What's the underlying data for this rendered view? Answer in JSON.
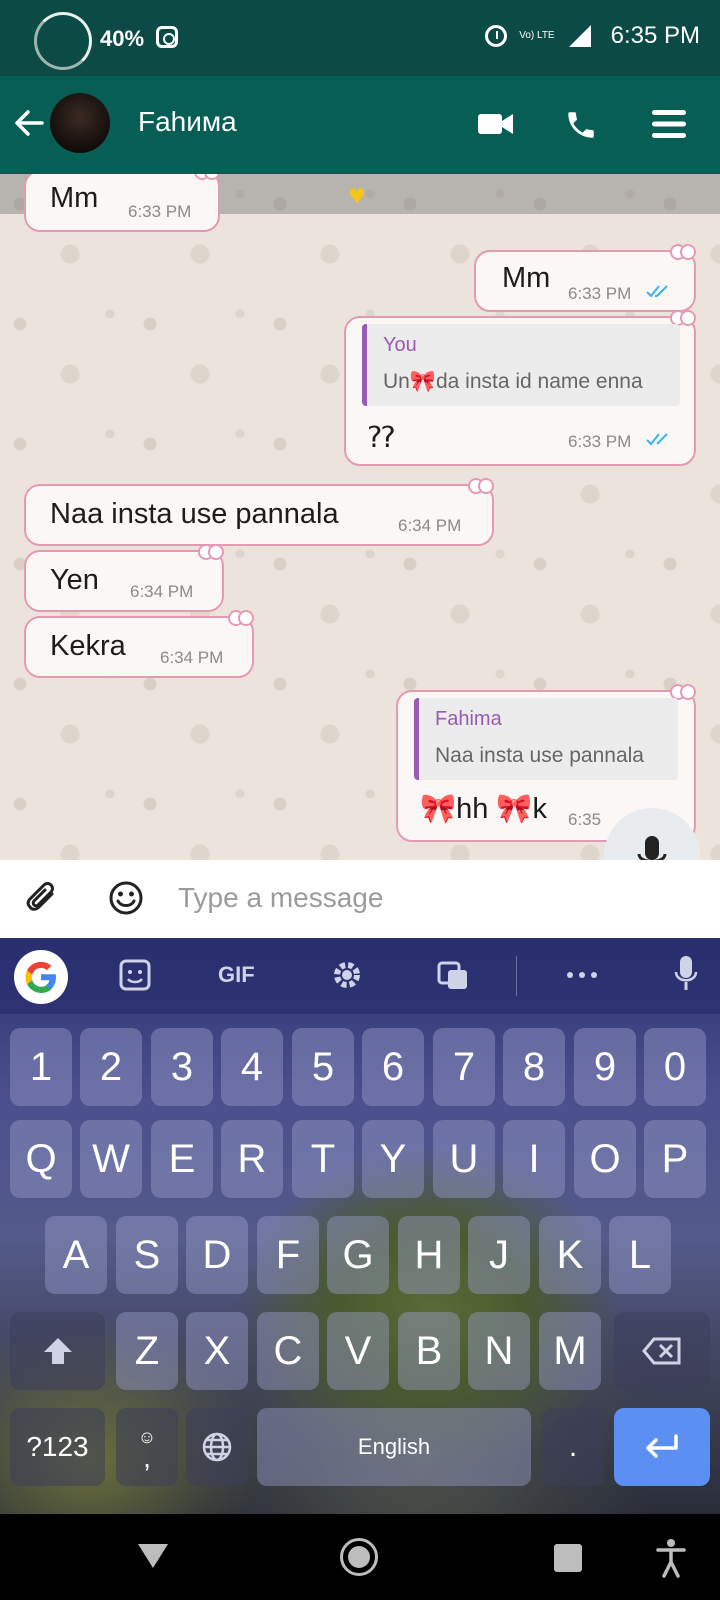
{
  "status_bar": {
    "battery": "40%",
    "network": "Vo) LTE",
    "time": "6:35 PM"
  },
  "header": {
    "contact_name": "Fahима",
    "icons": [
      "back-arrow-icon",
      "video-call-icon",
      "phone-icon",
      "menu-icon"
    ]
  },
  "messages": [
    {
      "direction": "in",
      "text": "Mm",
      "time": "6:33 PM"
    },
    {
      "direction": "out",
      "text": "Mm",
      "time": "6:33 PM",
      "read": true
    },
    {
      "direction": "out",
      "quote_author": "You",
      "quote_text": "Un🎀da insta id name enna",
      "text": "⁇",
      "time": "6:33 PM",
      "read": true
    },
    {
      "direction": "in",
      "text": "Naa insta use pannala",
      "time": "6:34 PM"
    },
    {
      "direction": "in",
      "text": "Yen",
      "time": "6:34 PM"
    },
    {
      "direction": "in",
      "text": "Kekra",
      "time": "6:34 PM"
    },
    {
      "direction": "out",
      "quote_author": "Fahima",
      "quote_text": "Naa insta use pannala",
      "text": "🎀hh 🎀k",
      "time": "6:35"
    }
  ],
  "input": {
    "placeholder": "Type a message"
  },
  "keyboard": {
    "toolbar": {
      "gif": "GIF"
    },
    "row_numbers": [
      "1",
      "2",
      "3",
      "4",
      "5",
      "6",
      "7",
      "8",
      "9",
      "0"
    ],
    "row1": [
      "Q",
      "W",
      "E",
      "R",
      "T",
      "Y",
      "U",
      "I",
      "O",
      "P"
    ],
    "row2": [
      "A",
      "S",
      "D",
      "F",
      "G",
      "H",
      "J",
      "K",
      "L"
    ],
    "row3": [
      "Z",
      "X",
      "C",
      "V",
      "B",
      "N",
      "M"
    ],
    "symbols_key": "?123",
    "comma_key": ",",
    "space_label": "English",
    "period_key": "."
  }
}
